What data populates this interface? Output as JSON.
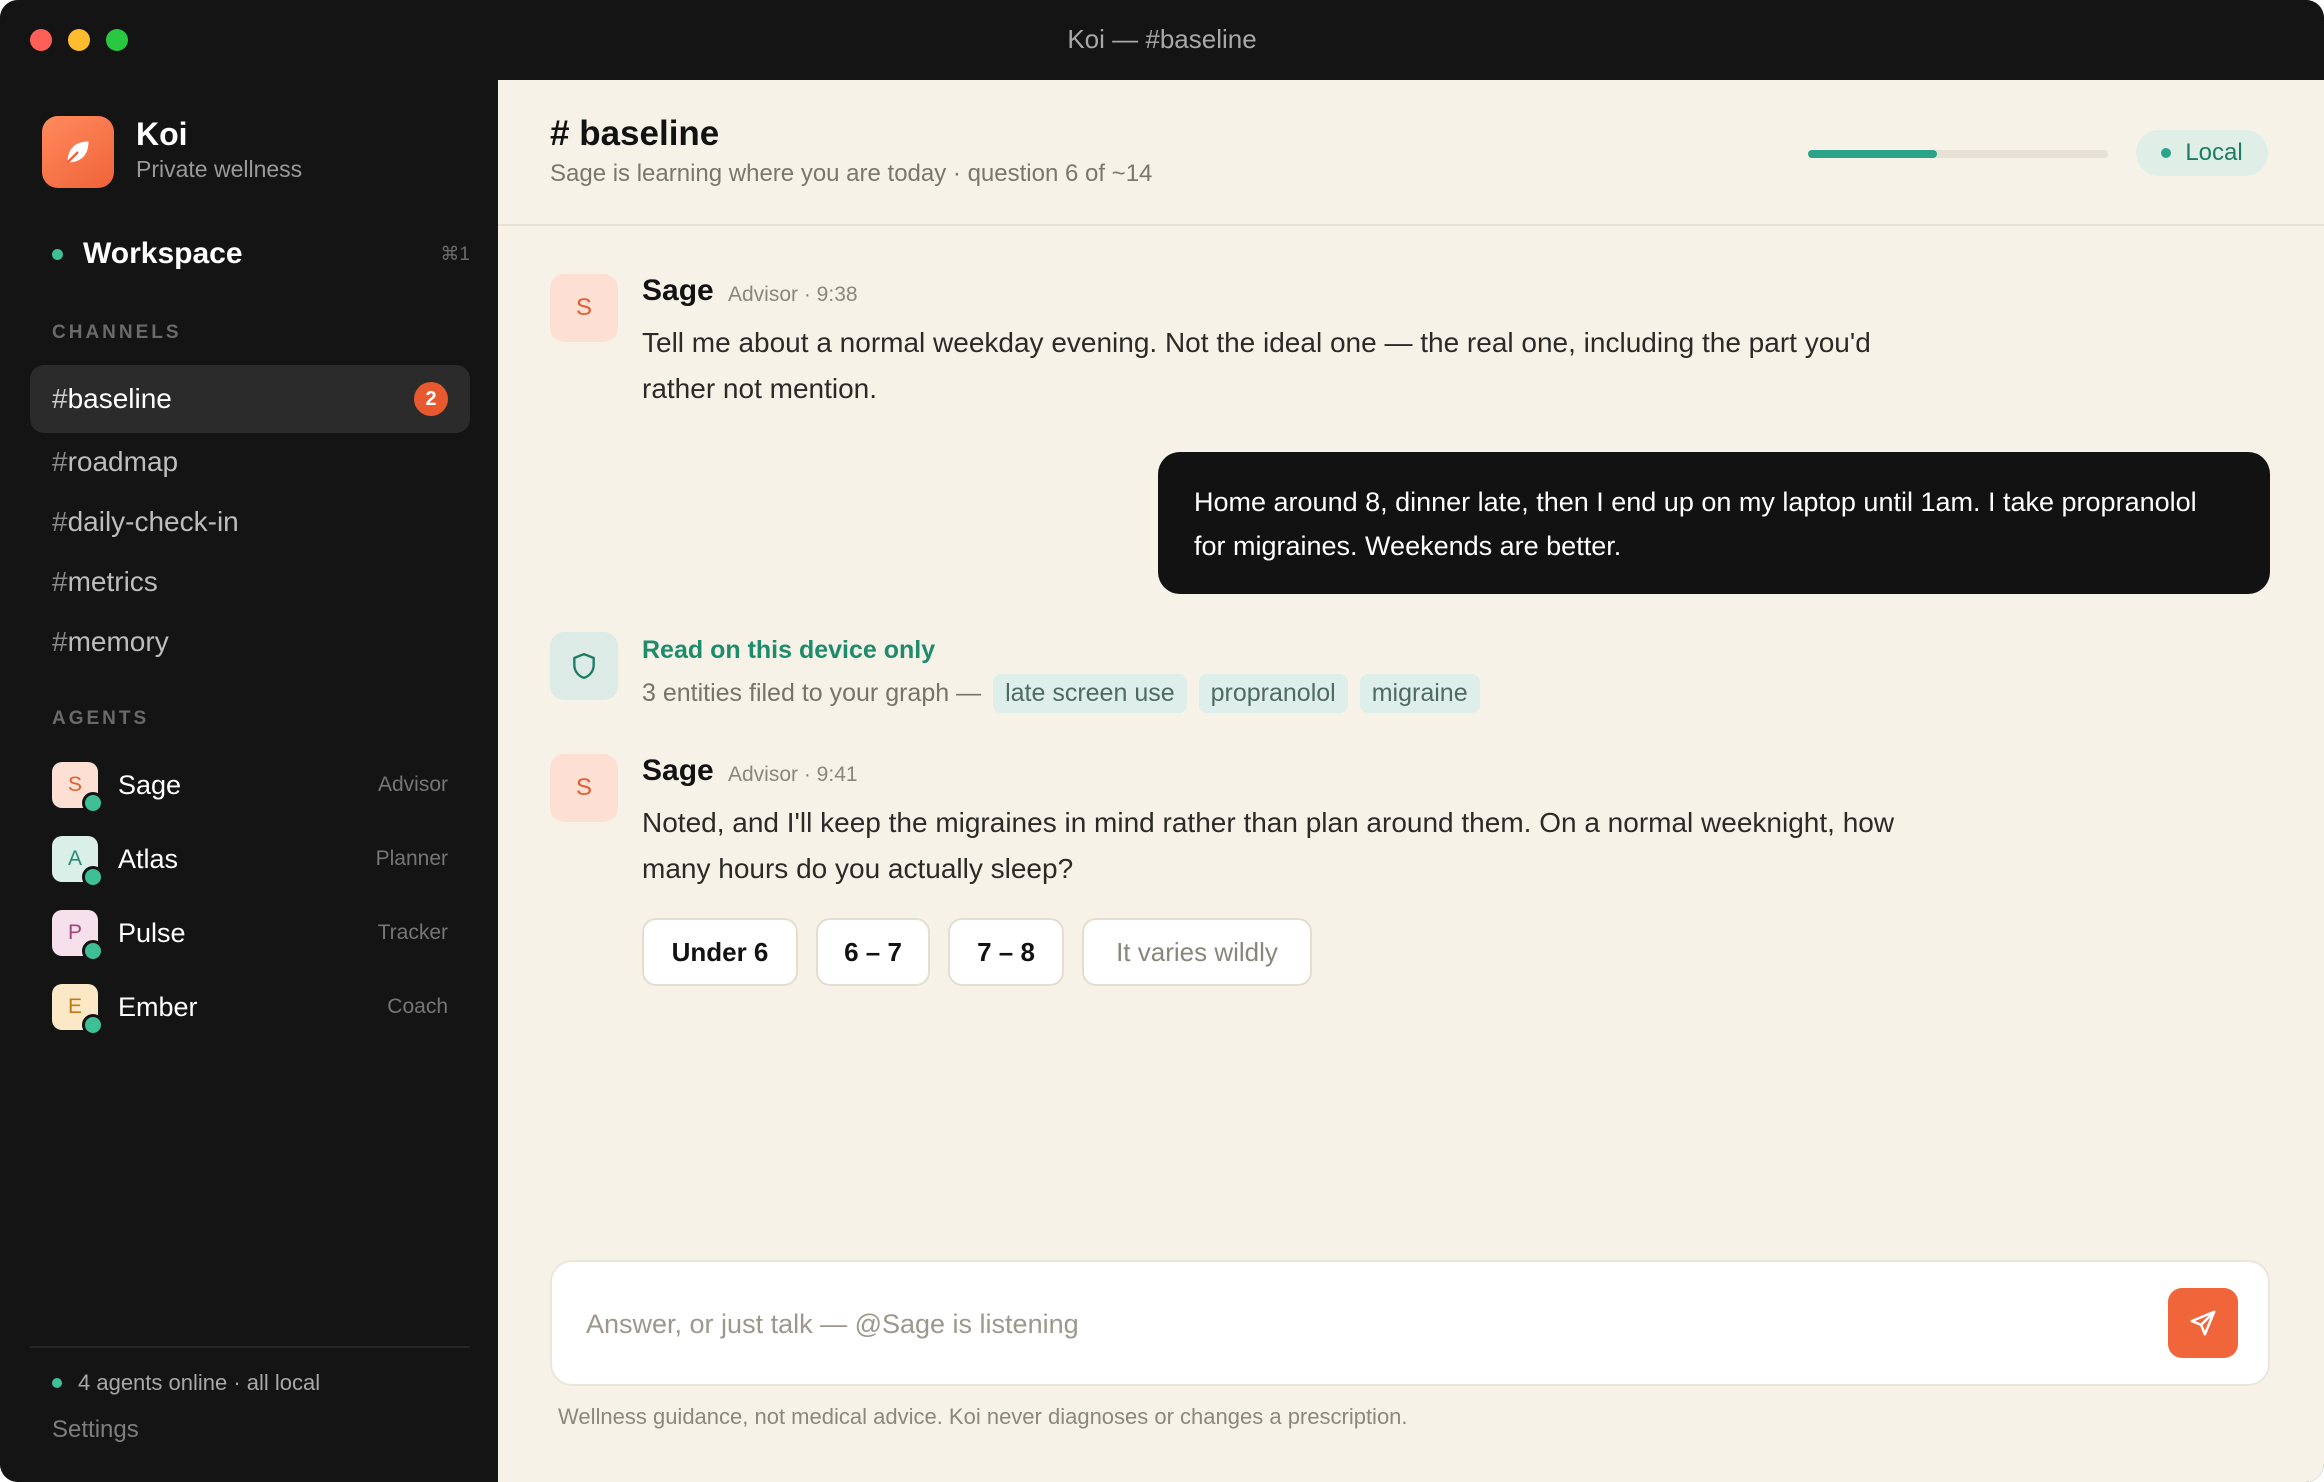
{
  "window": {
    "title": "Koi — #baseline"
  },
  "brand": {
    "name": "Koi",
    "subtitle": "Private wellness"
  },
  "sidebar": {
    "workspace": {
      "label": "Workspace",
      "shortcut": "⌘1"
    },
    "channels_heading": "CHANNELS",
    "channels": [
      {
        "name": "baseline",
        "badge": "2",
        "active": true
      },
      {
        "name": "roadmap"
      },
      {
        "name": "daily-check-in"
      },
      {
        "name": "metrics"
      },
      {
        "name": "memory"
      }
    ],
    "agents_heading": "AGENTS",
    "agents": [
      {
        "initial": "S",
        "name": "Sage",
        "role": "Advisor"
      },
      {
        "initial": "A",
        "name": "Atlas",
        "role": "Planner"
      },
      {
        "initial": "P",
        "name": "Pulse",
        "role": "Tracker"
      },
      {
        "initial": "E",
        "name": "Ember",
        "role": "Coach"
      }
    ],
    "status": "4 agents online · all local",
    "settings": "Settings"
  },
  "header": {
    "title": "# baseline",
    "subtitle": "Sage is learning where you are today · question 6 of ~14",
    "progress": 0.43,
    "local_label": "Local"
  },
  "messages": [
    {
      "avatar": "S",
      "author": "Sage",
      "meta": "Advisor · 9:38",
      "text": "Tell me about a normal weekday evening. Not the ideal one — the real one, including the part you'd rather not mention."
    },
    {
      "from_user": true,
      "text": "Home around 8, dinner late, then I end up on my laptop until 1am. I take propranolol for migraines. Weekends are better."
    },
    {
      "avatar": "S",
      "author": "Sage",
      "meta": "Advisor · 9:41",
      "text": "Noted, and I'll keep the migraines in mind rather than plan around them. On a normal weeknight, how many hours do you actually sleep?"
    }
  ],
  "privacy": {
    "title": "Read on this device only",
    "text": "3 entities filed to your graph —",
    "entities": [
      "late screen use",
      "propranolol",
      "migraine"
    ]
  },
  "options": [
    "Under 6",
    "6 – 7",
    "7 – 8",
    "It varies wildly"
  ],
  "composer": {
    "placeholder": "Answer, or just talk — @Sage is listening"
  },
  "disclaimer": "Wellness guidance, not medical advice. Koi never diagnoses or changes a prescription.",
  "colors": {
    "accent": "#f0663a",
    "teal": "#2aa388",
    "sidebar_bg": "#141414",
    "main_bg": "#f7f2e8"
  },
  "icons": [
    "leaf-icon",
    "shield-icon",
    "send-icon"
  ]
}
